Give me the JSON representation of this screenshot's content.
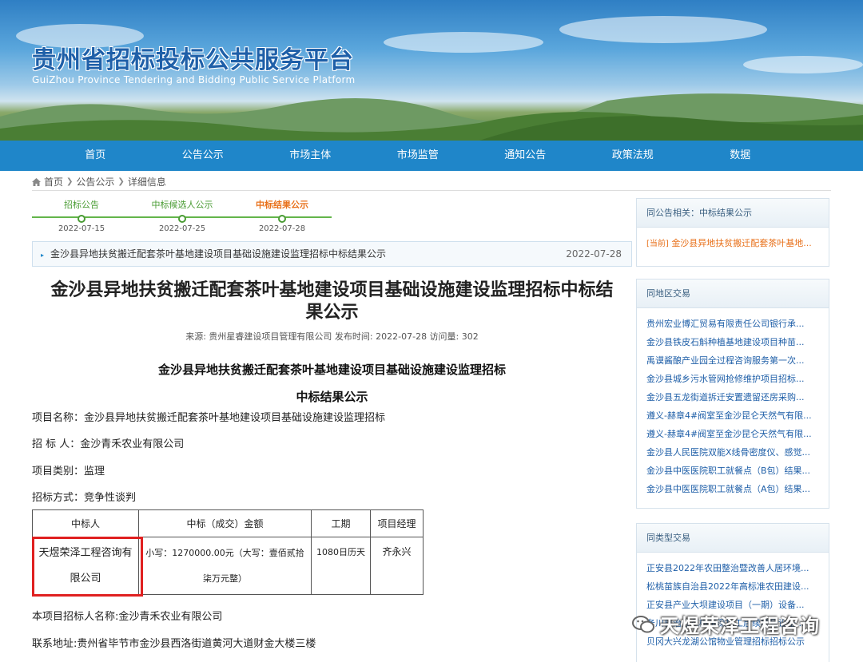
{
  "header": {
    "title": "贵州省招标投标公共服务平台",
    "subtitle": "GuiZhou Province Tendering and Bidding Public Service Platform"
  },
  "nav": [
    "首页",
    "公告公示",
    "市场主体",
    "市场监管",
    "通知公告",
    "政策法规",
    "数据"
  ],
  "breadcrumb": [
    "首页",
    "公告公示",
    "详细信息"
  ],
  "timeline": [
    {
      "label": "招标公告",
      "date": "2022-07-15"
    },
    {
      "label": "中标候选人公示",
      "date": "2022-07-25"
    },
    {
      "label": "中标结果公示",
      "date": "2022-07-28"
    }
  ],
  "announcement": {
    "title": "金沙县异地扶贫搬迁配套茶叶基地建设项目基础设施建设监理招标中标结果公示",
    "date": "2022-07-28"
  },
  "article": {
    "title_line1": "金沙县异地扶贫搬迁配套茶叶基地建设项目基础设施建设监理招标中标结",
    "title_line2": "果公示",
    "meta": "来源: 贵州星睿建设项目管理有限公司   发布时间: 2022-07-28   访问量: 302",
    "heading1": "金沙县异地扶贫搬迁配套茶叶基地建设项目基础设施建设监理招标",
    "heading2": "中标结果公示",
    "project_name": "项目名称：金沙县异地扶贫搬迁配套茶叶基地建设项目基础设施建设监理招标",
    "tenderer": "招 标 人：金沙青禾农业有限公司",
    "category": "项目类别：监理",
    "method": "招标方式：竞争性谈判",
    "table_headers": [
      "中标人",
      "中标（成交）金额",
      "工期",
      "项目经理"
    ],
    "table_row": {
      "winner_line1": "天煜荣泽工程咨询有",
      "winner_line2": "限公司",
      "amount_line1": "小写：1270000.00元（大写：壹佰贰拾",
      "amount_line2": "柒万元整）",
      "period": "1080日历天",
      "manager": "齐永兴"
    },
    "footer1": "本项目招标人名称:金沙青禾农业有限公司",
    "footer2": "联系地址:贵州省毕节市金沙县西洛街道黄河大道财金大楼三楼"
  },
  "sidebar": {
    "related": {
      "title": "同公告相关：中标结果公示",
      "current_tag": "[当前]",
      "current_link": "金沙县异地扶贫搬迁配套茶叶基地..."
    },
    "region": {
      "title": "同地区交易",
      "links": [
        "贵州宏业博汇贸易有限责任公司银行承...",
        "金沙县铁皮石斛种植基地建设项目种苗...",
        "禹谟酱酿产业园全过程咨询服务第一次...",
        "金沙县城乡污水管网抢修维护项目招标...",
        "金沙县五龙街道拆迁安置遗留还房采购...",
        "遵义-赫章4#阀室至金沙昆仑天然气有限...",
        "遵义-赫章4#阀室至金沙昆仑天然气有限...",
        "金沙县人民医院双能X线骨密度仪、感觉...",
        "金沙县中医医院职工就餐点（B包）结果...",
        "金沙县中医医院职工就餐点（A包）结果..."
      ]
    },
    "type": {
      "title": "同类型交易",
      "links": [
        "正安县2022年农田整治暨改善人居环境...",
        "松桃苗族自治县2022年高标准农田建设...",
        "正安县产业大坝建设项目（一期）设备...",
        "务川自治县花椒精深加工后续项目设备...",
        "贝冈大兴龙湖公馆物业管理招标招标公示"
      ]
    }
  },
  "watermark": "天煜荣泽工程咨询"
}
